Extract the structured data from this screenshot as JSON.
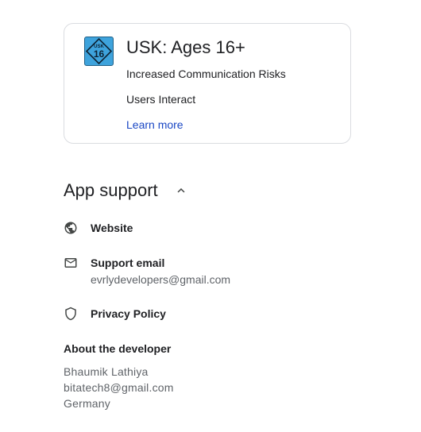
{
  "rating": {
    "badge": {
      "top_text": "USK",
      "number": "16",
      "color": "#3ea3dc"
    },
    "title": "USK: Ages 16+",
    "descriptors": [
      "Increased Communication Risks",
      "Users Interact"
    ],
    "learn_more": "Learn more",
    "link_color": "#1a47c4"
  },
  "app_support": {
    "title": "App support",
    "toggle_icon": "chevron-up-icon",
    "expanded": true,
    "items": [
      {
        "icon": "globe-icon",
        "label": "Website"
      },
      {
        "icon": "mail-icon",
        "label": "Support email",
        "sub": "evrlydevelopers@gmail.com"
      },
      {
        "icon": "shield-icon",
        "label": "Privacy Policy"
      }
    ]
  },
  "about_developer": {
    "heading": "About the developer",
    "name": "Bhaumik Lathiya",
    "email": "bitatech8@gmail.com",
    "country": "Germany"
  }
}
